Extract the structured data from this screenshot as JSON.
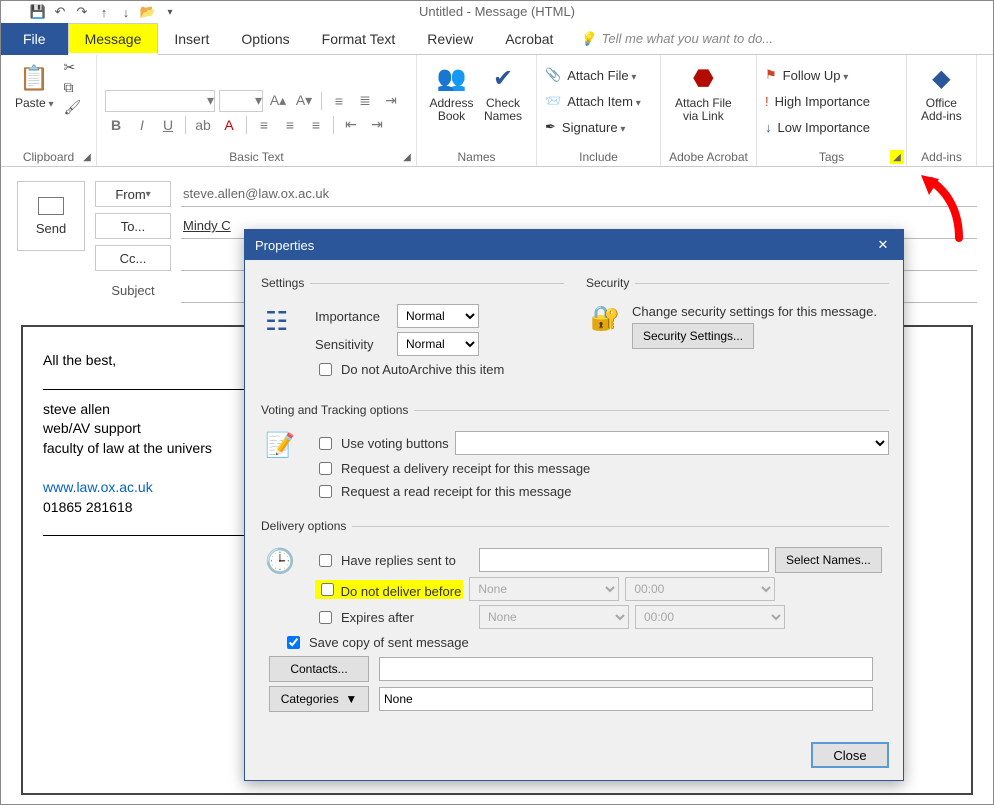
{
  "window": {
    "title": "Untitled - Message (HTML)"
  },
  "tabs": {
    "file": "File",
    "message": "Message",
    "insert": "Insert",
    "options": "Options",
    "format": "Format Text",
    "review": "Review",
    "acrobat": "Acrobat",
    "tellme": "Tell me what you want to do..."
  },
  "ribbon": {
    "clipboard": {
      "paste": "Paste",
      "label": "Clipboard"
    },
    "basictext": {
      "label": "Basic Text"
    },
    "names": {
      "address": "Address\nBook",
      "check": "Check\nNames",
      "label": "Names"
    },
    "include": {
      "attachfile": "Attach File",
      "attachitem": "Attach Item",
      "signature": "Signature",
      "label": "Include"
    },
    "adobe": {
      "attach": "Attach File\nvia Link",
      "label": "Adobe Acrobat"
    },
    "tags": {
      "followup": "Follow Up",
      "high": "High Importance",
      "low": "Low Importance",
      "label": "Tags"
    },
    "addins": {
      "office": "Office\nAdd-ins",
      "label": "Add-ins"
    }
  },
  "compose": {
    "send": "Send",
    "from": "From",
    "to": "To...",
    "cc": "Cc...",
    "subject": "Subject",
    "from_value": "steve.allen@law.ox.ac.uk",
    "to_value": "Mindy C"
  },
  "body": {
    "line1": "All the best,",
    "sig1": "steve allen",
    "sig2": "web/AV support",
    "sig3": "faculty of law at the univers",
    "link": "www.law.ox.ac.uk",
    "phone": "01865 281618"
  },
  "dialog": {
    "title": "Properties",
    "settings_legend": "Settings",
    "security_legend": "Security",
    "importance": "Importance",
    "importance_val": "Normal",
    "sensitivity": "Sensitivity",
    "sensitivity_val": "Normal",
    "autoarchive": "Do not AutoArchive this item",
    "security_text": "Change security settings for this message.",
    "security_btn": "Security Settings...",
    "voting_legend": "Voting and Tracking options",
    "use_voting": "Use voting buttons",
    "delivery_receipt": "Request a delivery receipt for this message",
    "read_receipt": "Request a read receipt for this message",
    "delivery_legend": "Delivery options",
    "have_replies": "Have replies sent to",
    "select_names": "Select Names...",
    "do_not_deliver": "Do not deliver before",
    "none": "None",
    "time": "00:00",
    "expires": "Expires after",
    "save_copy": "Save copy of sent message",
    "contacts": "Contacts...",
    "categories": "Categories",
    "categories_val": "None",
    "close": "Close"
  }
}
